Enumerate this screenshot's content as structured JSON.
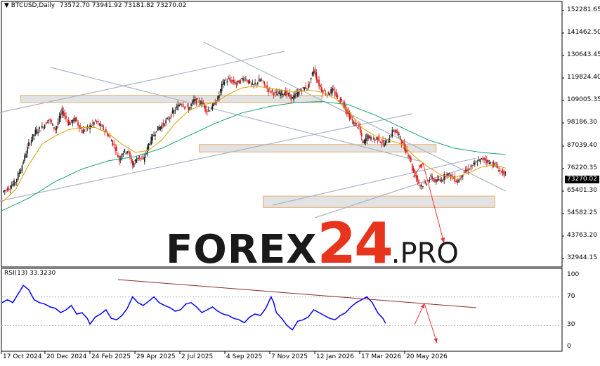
{
  "header": {
    "symbol": "BTCUSD,Daily",
    "ohlc": "73572.70 73941.92 73181.82 73270.02"
  },
  "rsi_header": "RSI(13) 33.3230",
  "watermark": {
    "part1": "FOREX",
    "part2": "24",
    "part3": ".PRO"
  },
  "colors": {
    "candle_bull": "#1a1a1a",
    "candle_bear": "#d01515",
    "ma_fast": "#e0a000",
    "ma_slow": "#1aa37a",
    "trend_lines": "#aab4c8",
    "zone_fill": "#e2e2e2",
    "zone_border": "#e8b070",
    "rsi_line": "#0000ff",
    "rsi_trend": "#8b2b2b",
    "arrow": "#ee3333"
  },
  "chart_data": [
    {
      "type": "candlestick",
      "title": "BTCUSD,Daily",
      "x_tick_labels": [
        "17 Oct 2024",
        "20 Dec 2024",
        "24 Feb 2025",
        "29 Apr 2025",
        "2 Jul 2025",
        "4 Sep 2025",
        "7 Nov 2025",
        "12 Jan 2026",
        "17 Mar 2026",
        "20 May 2026"
      ],
      "y_tick_labels": [
        "152281.65",
        "141462.50",
        "130643.45",
        "119824.40",
        "109005.35",
        "98186.30",
        "87039.40",
        "76220.35",
        "65401.30",
        "54582.25",
        "43763.20",
        "32944.15"
      ],
      "last_price": "73270.02",
      "ylim": [
        32944.15,
        152281.65
      ],
      "close_path": [
        [
          0,
          65000
        ],
        [
          5,
          67000
        ],
        [
          10,
          70000
        ],
        [
          15,
          78000
        ],
        [
          20,
          88000
        ],
        [
          25,
          94000
        ],
        [
          30,
          96000
        ],
        [
          35,
          100000
        ],
        [
          40,
          95000
        ],
        [
          45,
          104000
        ],
        [
          50,
          98000
        ],
        [
          55,
          100000
        ],
        [
          60,
          94000
        ],
        [
          65,
          96000
        ],
        [
          70,
          99000
        ],
        [
          75,
          96000
        ],
        [
          80,
          92000
        ],
        [
          85,
          86000
        ],
        [
          88,
          80000
        ],
        [
          90,
          84000
        ],
        [
          94,
          85000
        ],
        [
          98,
          78000
        ],
        [
          102,
          82000
        ],
        [
          106,
          80000
        ],
        [
          110,
          88000
        ],
        [
          116,
          95000
        ],
        [
          122,
          98000
        ],
        [
          128,
          103000
        ],
        [
          134,
          108000
        ],
        [
          140,
          105000
        ],
        [
          144,
          109000
        ],
        [
          150,
          108000
        ],
        [
          154,
          104000
        ],
        [
          158,
          106000
        ],
        [
          162,
          110000
        ],
        [
          166,
          118000
        ],
        [
          170,
          119000
        ],
        [
          176,
          117000
        ],
        [
          182,
          120000
        ],
        [
          188,
          116000
        ],
        [
          194,
          119000
        ],
        [
          200,
          114000
        ],
        [
          206,
          112000
        ],
        [
          212,
          113000
        ],
        [
          218,
          110000
        ],
        [
          224,
          114000
        ],
        [
          230,
          116000
        ],
        [
          234,
          124000
        ],
        [
          237,
          118000
        ],
        [
          240,
          114000
        ],
        [
          244,
          112000
        ],
        [
          248,
          114000
        ],
        [
          252,
          110000
        ],
        [
          256,
          108000
        ],
        [
          260,
          102000
        ],
        [
          264,
          98000
        ],
        [
          268,
          96000
        ],
        [
          271,
          88000
        ],
        [
          274,
          92000
        ],
        [
          278,
          90000
        ],
        [
          282,
          91000
        ],
        [
          286,
          88000
        ],
        [
          290,
          90000
        ],
        [
          294,
          95000
        ],
        [
          298,
          92000
        ],
        [
          302,
          86000
        ],
        [
          306,
          82000
        ],
        [
          308,
          76000
        ],
        [
          311,
          72000
        ],
        [
          314,
          68000
        ],
        [
          318,
          69000
        ],
        [
          322,
          72000
        ],
        [
          326,
          70000
        ],
        [
          330,
          71000
        ],
        [
          334,
          74000
        ],
        [
          338,
          72000
        ],
        [
          342,
          70000
        ],
        [
          346,
          74000
        ],
        [
          350,
          76000
        ],
        [
          354,
          78000
        ],
        [
          358,
          80000
        ],
        [
          362,
          81000
        ],
        [
          366,
          79000
        ],
        [
          370,
          78000
        ],
        [
          374,
          75000
        ],
        [
          378,
          73270
        ]
      ],
      "ma_fast_path": [
        [
          0,
          60000
        ],
        [
          10,
          66000
        ],
        [
          20,
          78000
        ],
        [
          30,
          88000
        ],
        [
          40,
          92000
        ],
        [
          50,
          95000
        ],
        [
          60,
          96000
        ],
        [
          70,
          96000
        ],
        [
          80,
          93000
        ],
        [
          90,
          88000
        ],
        [
          100,
          84000
        ],
        [
          110,
          85000
        ],
        [
          120,
          90000
        ],
        [
          130,
          98000
        ],
        [
          140,
          104000
        ],
        [
          150,
          107000
        ],
        [
          160,
          108000
        ],
        [
          170,
          112000
        ],
        [
          180,
          115000
        ],
        [
          190,
          116000
        ],
        [
          200,
          115000
        ],
        [
          210,
          114000
        ],
        [
          220,
          113000
        ],
        [
          230,
          114000
        ],
        [
          240,
          113000
        ],
        [
          250,
          110000
        ],
        [
          260,
          104000
        ],
        [
          270,
          96000
        ],
        [
          280,
          92000
        ],
        [
          290,
          90000
        ],
        [
          300,
          88000
        ],
        [
          310,
          82000
        ],
        [
          320,
          77000
        ],
        [
          330,
          73000
        ],
        [
          340,
          72000
        ],
        [
          350,
          74000
        ],
        [
          360,
          77000
        ],
        [
          370,
          78000
        ],
        [
          378,
          76500
        ]
      ],
      "ma_slow_path": [
        [
          0,
          56000
        ],
        [
          20,
          62000
        ],
        [
          40,
          70000
        ],
        [
          60,
          76000
        ],
        [
          80,
          80000
        ],
        [
          100,
          82000
        ],
        [
          120,
          86000
        ],
        [
          140,
          92000
        ],
        [
          160,
          98000
        ],
        [
          180,
          103000
        ],
        [
          200,
          106000
        ],
        [
          220,
          108000
        ],
        [
          240,
          108500
        ],
        [
          260,
          107000
        ],
        [
          280,
          102000
        ],
        [
          300,
          96000
        ],
        [
          320,
          90000
        ],
        [
          340,
          86000
        ],
        [
          360,
          84000
        ],
        [
          378,
          83000
        ]
      ],
      "resistance_zones": [
        {
          "x_start": 14,
          "x_end": 240,
          "y_low": 108000,
          "y_high": 111500
        },
        {
          "x_start": 148,
          "x_end": 326,
          "y_low": 84200,
          "y_high": 87800
        },
        {
          "x_start": 196,
          "x_end": 370,
          "y_low": 57500,
          "y_high": 63000
        }
      ]
    },
    {
      "type": "line",
      "title": "RSI(13) 33.3230",
      "y_tick_labels": [
        "100",
        "70",
        "30",
        "0"
      ],
      "ylim": [
        0,
        100
      ],
      "rsi_path": [
        [
          0,
          62
        ],
        [
          4,
          66
        ],
        [
          8,
          62
        ],
        [
          12,
          74
        ],
        [
          16,
          86
        ],
        [
          20,
          80
        ],
        [
          24,
          66
        ],
        [
          28,
          62
        ],
        [
          32,
          60
        ],
        [
          36,
          56
        ],
        [
          40,
          54
        ],
        [
          44,
          48
        ],
        [
          48,
          52
        ],
        [
          52,
          58
        ],
        [
          56,
          46
        ],
        [
          60,
          48
        ],
        [
          64,
          40
        ],
        [
          66,
          32
        ],
        [
          70,
          42
        ],
        [
          74,
          46
        ],
        [
          78,
          52
        ],
        [
          82,
          40
        ],
        [
          86,
          38
        ],
        [
          90,
          44
        ],
        [
          94,
          54
        ],
        [
          98,
          70
        ],
        [
          102,
          62
        ],
        [
          106,
          58
        ],
        [
          110,
          64
        ],
        [
          114,
          70
        ],
        [
          118,
          62
        ],
        [
          122,
          58
        ],
        [
          126,
          55
        ],
        [
          130,
          50
        ],
        [
          134,
          52
        ],
        [
          138,
          60
        ],
        [
          142,
          62
        ],
        [
          146,
          56
        ],
        [
          150,
          48
        ],
        [
          154,
          52
        ],
        [
          158,
          56
        ],
        [
          162,
          50
        ],
        [
          166,
          46
        ],
        [
          170,
          44
        ],
        [
          174,
          40
        ],
        [
          178,
          38
        ],
        [
          182,
          34
        ],
        [
          186,
          42
        ],
        [
          190,
          46
        ],
        [
          194,
          44
        ],
        [
          198,
          54
        ],
        [
          202,
          70
        ],
        [
          204,
          62
        ],
        [
          206,
          48
        ],
        [
          210,
          40
        ],
        [
          214,
          30
        ],
        [
          218,
          24
        ],
        [
          222,
          36
        ],
        [
          226,
          38
        ],
        [
          230,
          42
        ],
        [
          234,
          52
        ],
        [
          238,
          48
        ],
        [
          242,
          44
        ],
        [
          246,
          40
        ],
        [
          250,
          38
        ],
        [
          254,
          44
        ],
        [
          258,
          48
        ],
        [
          262,
          56
        ],
        [
          266,
          62
        ],
        [
          270,
          66
        ],
        [
          274,
          70
        ],
        [
          278,
          62
        ],
        [
          282,
          48
        ],
        [
          286,
          40
        ],
        [
          288,
          33
        ]
      ]
    }
  ]
}
